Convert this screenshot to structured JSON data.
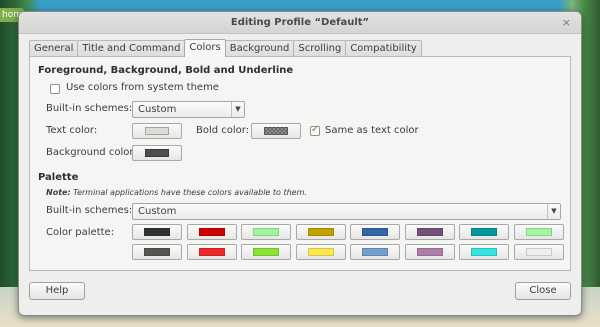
{
  "desktop": {
    "tab_label": "hom"
  },
  "window": {
    "title": "Editing Profile “Default”",
    "close_glyph": "×"
  },
  "tabs": [
    {
      "label": "General"
    },
    {
      "label": "Title and Command"
    },
    {
      "label": "Colors",
      "active": true
    },
    {
      "label": "Background"
    },
    {
      "label": "Scrolling"
    },
    {
      "label": "Compatibility"
    }
  ],
  "fg_section": {
    "title": "Foreground, Background, Bold and Underline",
    "use_system_theme_label": "Use colors from system theme",
    "use_system_theme_checked": false,
    "builtin_label": "Built-in schemes:",
    "builtin_value": "Custom",
    "text_color_label": "Text color:",
    "text_color": "#dcdcd8",
    "bold_color_label": "Bold color:",
    "same_as_text_label": "Same as text color",
    "same_as_text_checked": true,
    "bg_color_label": "Background color:",
    "bg_color": "#4e4f4c"
  },
  "palette_section": {
    "title": "Palette",
    "note_prefix": "Note:",
    "note_text": " Terminal applications have these colors available to them.",
    "builtin_label": "Built-in schemes:",
    "builtin_value": "Custom",
    "palette_label": "Color palette:",
    "row1": [
      "#2e3436",
      "#cc0000",
      "#9ff59f",
      "#c4a000",
      "#3465a4",
      "#75507b",
      "#06989a",
      "#a2f7a2"
    ],
    "row2": [
      "#555753",
      "#ef2929",
      "#8ae234",
      "#fce94f",
      "#729fcf",
      "#ad7fa8",
      "#34e2e2",
      "#eeeeec"
    ]
  },
  "buttons": {
    "help_label": "Help",
    "close_label": "Close"
  },
  "icons": {
    "dropdown": "chevron-down-icon",
    "close": "close-icon",
    "check": "check-icon"
  }
}
